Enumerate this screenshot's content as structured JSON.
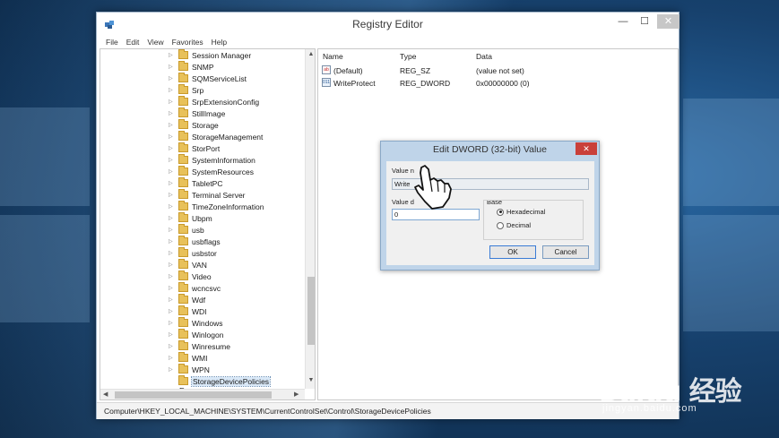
{
  "window": {
    "title": "Registry Editor",
    "minimize": "—",
    "maximize": "☐",
    "close": "✕"
  },
  "menu": [
    "File",
    "Edit",
    "View",
    "Favorites",
    "Help"
  ],
  "tree": {
    "items": [
      "Session Manager",
      "SNMP",
      "SQMServiceList",
      "Srp",
      "SrpExtensionConfig",
      "StillImage",
      "Storage",
      "StorageManagement",
      "StorPort",
      "SystemInformation",
      "SystemResources",
      "TabletPC",
      "Terminal Server",
      "TimeZoneInformation",
      "Ubpm",
      "usb",
      "usbflags",
      "usbstor",
      "VAN",
      "Video",
      "wcncsvc",
      "Wdf",
      "WDI",
      "Windows",
      "Winlogon",
      "Winresume",
      "WMI",
      "WPN",
      "StorageDevicePolicies"
    ],
    "selected": "StorageDevicePolicies",
    "partial_next": "Enum"
  },
  "list": {
    "columns": [
      "Name",
      "Type",
      "Data"
    ],
    "rows": [
      {
        "icon": "string-value-icon",
        "icon_text": "ab",
        "name": "(Default)",
        "type": "REG_SZ",
        "data": "(value not set)"
      },
      {
        "icon": "dword-value-icon",
        "icon_text": "011",
        "name": "WriteProtect",
        "type": "REG_DWORD",
        "data": "0x00000000 (0)"
      }
    ]
  },
  "status": {
    "path": "Computer\\HKEY_LOCAL_MACHINE\\SYSTEM\\CurrentControlSet\\Control\\StorageDevicePolicies"
  },
  "dialog": {
    "title": "Edit DWORD (32-bit) Value",
    "close": "✕",
    "value_name_label": "Value n",
    "value_name": "Write",
    "value_data_label": "Value d",
    "value_data": "0",
    "base_label": "Base",
    "options": [
      "Hexadecimal",
      "Decimal"
    ],
    "selected_option": "Hexadecimal",
    "ok": "OK",
    "cancel": "Cancel"
  },
  "watermark": {
    "main": "Baidu 经验",
    "sub": "jingyan.baidu.com"
  }
}
